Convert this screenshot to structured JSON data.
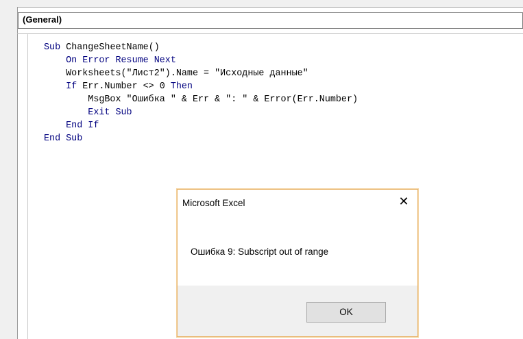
{
  "procedure_combo": {
    "value": "(General)"
  },
  "code": {
    "lines": [
      [
        {
          "t": "Sub ",
          "c": "kw"
        },
        {
          "t": "ChangeSheetName()",
          "c": "txt"
        }
      ],
      [
        {
          "t": "    On Error Resume Next",
          "c": "kw"
        }
      ],
      [
        {
          "t": "    Worksheets(\"Лист2\").Name = \"Исходные данные\"",
          "c": "txt"
        }
      ],
      [
        {
          "t": "    If ",
          "c": "kw"
        },
        {
          "t": "Err.Number <> 0 ",
          "c": "txt"
        },
        {
          "t": "Then",
          "c": "kw"
        }
      ],
      [
        {
          "t": "        MsgBox \"Ошибка \" & Err & \": \" & Error(Err.Number)",
          "c": "txt"
        }
      ],
      [
        {
          "t": "        Exit Sub",
          "c": "kw"
        }
      ],
      [
        {
          "t": "    End If",
          "c": "kw"
        }
      ],
      [
        {
          "t": "End Sub",
          "c": "kw"
        }
      ]
    ]
  },
  "msgbox": {
    "title": "Microsoft Excel",
    "close_glyph": "✕",
    "close_icon": "close-icon",
    "message": "Ошибка 9: Subscript out of range",
    "ok_label": "OK"
  },
  "colors": {
    "keyword": "#00007f",
    "text": "#000000",
    "dialog_border": "#e8b46a",
    "footer_bg": "#f0f0f0"
  }
}
